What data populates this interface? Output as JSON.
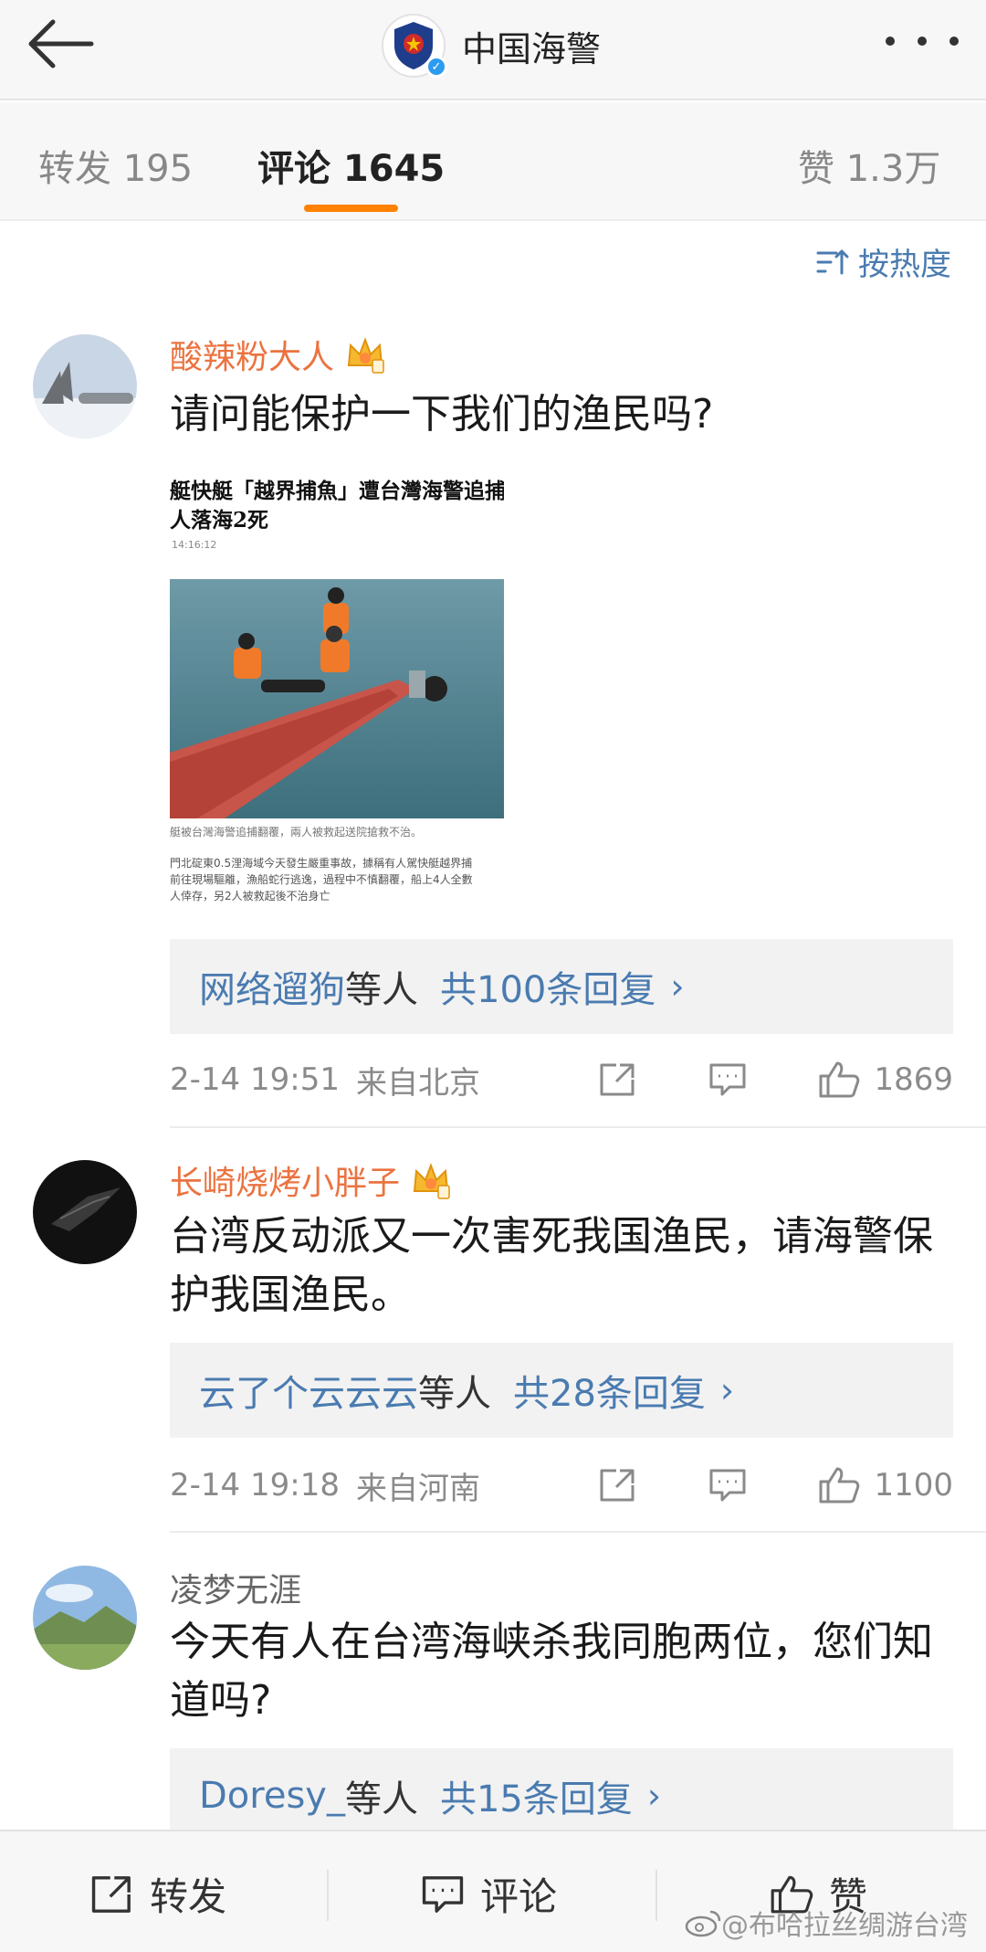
{
  "header": {
    "title": "中国海警"
  },
  "tabs": [
    {
      "label": "转发 195"
    },
    {
      "label": "评论 1645"
    },
    {
      "label": "赞 1.3万"
    }
  ],
  "sort_label": "按热度",
  "comments": [
    {
      "username": "酸辣粉大人",
      "text": "请问能保护一下我们的渔民吗?",
      "image": {
        "headline_1": "艇快艇「越界捕魚」遭台灣海警追捕",
        "headline_2": "人落海2死",
        "time": "14:16:12",
        "caption": "艇被台灣海警追捕翻覆，兩人被救起送院搶救不治。",
        "body_1": "門北碇東0.5浬海域今天發生嚴重事故，據稱有人駕快艇越界捕",
        "body_2": "前往現場驅離，漁船蛇行逃逸，過程中不慎翻覆，船上4人全數",
        "body_3": "人倖存，另2人被救起後不治身亡"
      },
      "reply_who": "网络遛狗",
      "reply_mid": "等人",
      "reply_count": "共100条回复",
      "time": "2-14 19:51",
      "location": "来自北京",
      "likes": "1869"
    },
    {
      "username": "长崎烧烤小胖子",
      "text": "台湾反动派又一次害死我国渔民，请海警保护我国渔民。",
      "reply_who": "云了个云云云",
      "reply_mid": "等人",
      "reply_count": "共28条回复",
      "time": "2-14 19:18",
      "location": "来自河南",
      "likes": "1100"
    },
    {
      "username": "凌梦无涯",
      "text": "今天有人在台湾海峡杀我同胞两位，您们知道吗?",
      "reply_who": "Doresy_",
      "reply_mid": "等人",
      "reply_count": "共15条回复"
    }
  ],
  "bottom": {
    "repost": "转发",
    "comment": "评论",
    "like": "赞"
  },
  "watermark": "@布哈拉丝绸游台湾",
  "colors": {
    "accent": "#ff8200",
    "link": "#4a7bb0",
    "vip_name": "#eb7340"
  }
}
